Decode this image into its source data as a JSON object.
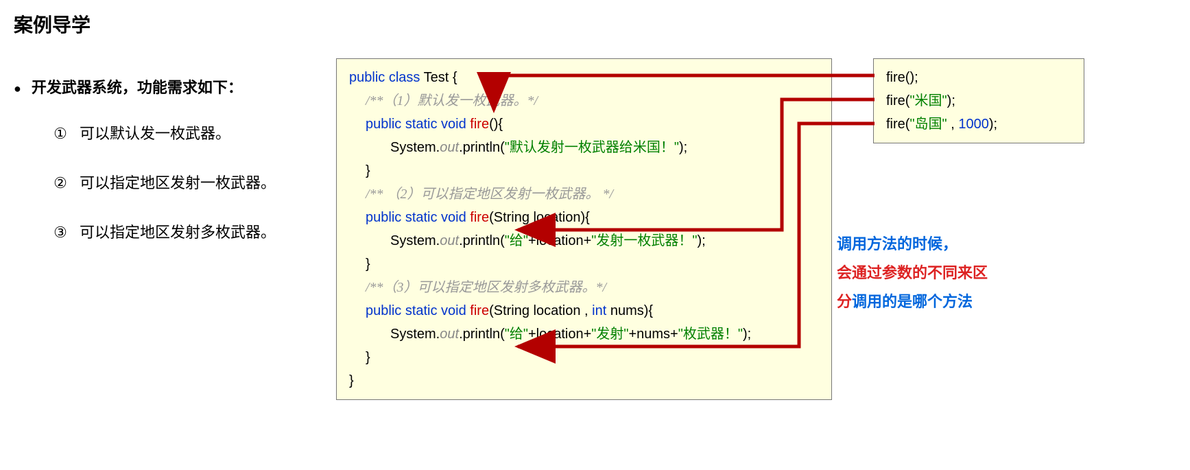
{
  "title": "案例导学",
  "intro": "开发武器系统，功能需求如下：",
  "reqs": {
    "n1": "①",
    "t1": "可以默认发一枚武器。",
    "n2": "②",
    "t2": "可以指定地区发射一枚武器。",
    "n3": "③",
    "t3": "可以指定地区发射多枚武器。"
  },
  "code": {
    "l1_kw1": "public class ",
    "l1_cls": "Test {",
    "c1": "/**（1）默认发一枚武器。*/",
    "m1_kw1": "public static void ",
    "m1_name": "fire",
    "m1_sig": "(){",
    "m1_b1": "System.",
    "m1_out": "out",
    "m1_b2": ".println(",
    "m1_str": "\"默认发射一枚武器给米国！\"",
    "m1_b3": ");",
    "brace_close": "}",
    "c2": "/** （2）可以指定地区发射一枚武器。 */",
    "m2_kw1": "public static void ",
    "m2_name": "fire",
    "m2_sig": "(String location){",
    "m2_b1": "System.",
    "m2_out": "out",
    "m2_b2": ".println(",
    "m2_s1": "\"给\"",
    "m2_b3": "+location+",
    "m2_s2": "\"发射一枚武器！\"",
    "m2_b4": ");",
    "c3": "/**（3）可以指定地区发射多枚武器。*/",
    "m3_kw1": "public static void ",
    "m3_name": "fire",
    "m3_siga": "(String location , ",
    "m3_int": "int ",
    "m3_sigb": "nums){",
    "m3_b1": "System.",
    "m3_out": "out",
    "m3_b2": ".println(",
    "m3_s1": "\"给\"",
    "m3_b3": "+location+",
    "m3_s2": "\"发射\"",
    "m3_b4": "+nums+",
    "m3_s3": "\"枚武器！\"",
    "m3_b5": ");"
  },
  "calls": {
    "c1a": "fire();",
    "c2a": "fire(",
    "c2b": "\"米国\"",
    "c2c": ");",
    "c3a": "fire(",
    "c3b": "\"岛国\" ",
    "c3c": ", ",
    "c3d": "1000",
    "c3e": ");"
  },
  "explain": {
    "p1": "调用方法的时候，",
    "p2a": "会通过参数的不同来区",
    "p2b": "分",
    "p3": "调用的是哪个方法"
  }
}
